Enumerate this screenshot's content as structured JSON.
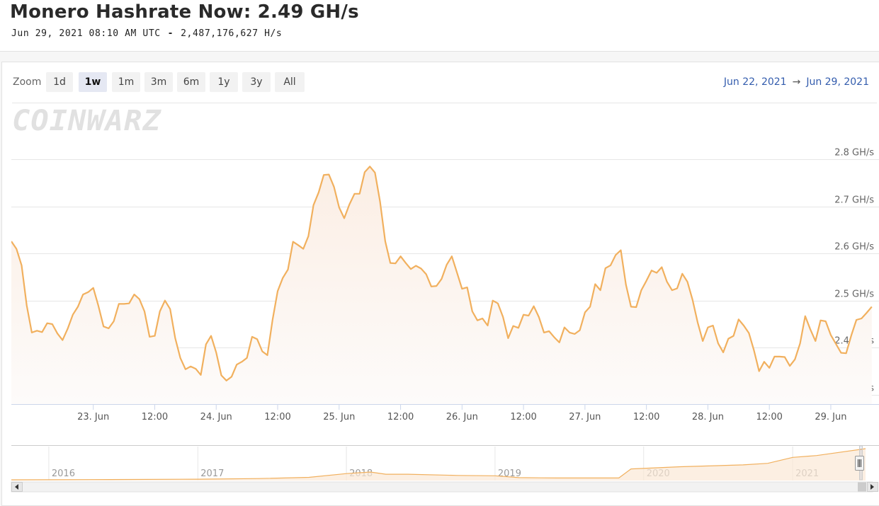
{
  "header": {
    "title": "Monero Hashrate Now: 2.49 GH/s",
    "timestamp": "Jun 29, 2021 08:10 AM UTC",
    "separator": "-",
    "hashrate_exact": "2,487,176,627 H/s"
  },
  "toolbar": {
    "zoom_label": "Zoom",
    "zoom_buttons": [
      "1d",
      "1w",
      "1m",
      "3m",
      "6m",
      "1y",
      "3y",
      "All"
    ],
    "active": "1w",
    "range_from": "Jun 22, 2021",
    "range_arrow": "→",
    "range_to": "Jun 29, 2021"
  },
  "watermark": "COINWARZ",
  "colors": {
    "line": "#f1b05e",
    "area_top": "#fbeee4",
    "area_bottom": "#fdfbfa",
    "grid": "#e6e6e6",
    "range_text": "#335cad"
  },
  "chart_data": {
    "type": "area",
    "title": "Monero Hashrate Now: 2.49 GH/s",
    "xlabel": "",
    "ylabel": "",
    "y_unit": "GH/s",
    "ylim": [
      2.28,
      2.82
    ],
    "yticks": [
      2.3,
      2.4,
      2.5,
      2.6,
      2.7,
      2.8
    ],
    "ytick_labels": [
      "2.3 GH/s",
      "2.4 GH/s",
      "2.5 GH/s",
      "2.6 GH/s",
      "2.7 GH/s",
      "2.8 GH/s"
    ],
    "xlim": [
      "2021-06-22T08:00",
      "2021-06-29T08:10"
    ],
    "xticks": [
      "2021-06-23T00:00",
      "2021-06-23T12:00",
      "2021-06-24T00:00",
      "2021-06-24T12:00",
      "2021-06-25T00:00",
      "2021-06-25T12:00",
      "2021-06-26T00:00",
      "2021-06-26T12:00",
      "2021-06-27T00:00",
      "2021-06-27T12:00",
      "2021-06-28T00:00",
      "2021-06-28T12:00",
      "2021-06-29T00:00",
      "2021-06-29T12:00"
    ],
    "xtick_labels": [
      "23. Jun",
      "12:00",
      "24. Jun",
      "12:00",
      "25. Jun",
      "12:00",
      "26. Jun",
      "12:00",
      "27. Jun",
      "12:00",
      "28. Jun",
      "12:00",
      "29. Jun",
      "12:00"
    ],
    "grid": true,
    "legend": "none",
    "series": [
      {
        "values": [
          [
            "2021-06-22T08:00",
            2.626
          ],
          [
            "2021-06-22T09:00",
            2.61
          ],
          [
            "2021-06-22T10:00",
            2.575
          ],
          [
            "2021-06-22T11:00",
            2.49
          ],
          [
            "2021-06-22T12:00",
            2.432
          ],
          [
            "2021-06-22T13:00",
            2.436
          ],
          [
            "2021-06-22T14:00",
            2.433
          ],
          [
            "2021-06-22T15:00",
            2.452
          ],
          [
            "2021-06-22T16:00",
            2.45
          ],
          [
            "2021-06-22T17:00",
            2.43
          ],
          [
            "2021-06-22T18:00",
            2.416
          ],
          [
            "2021-06-22T19:00",
            2.44
          ],
          [
            "2021-06-22T20:00",
            2.47
          ],
          [
            "2021-06-22T21:00",
            2.487
          ],
          [
            "2021-06-22T22:00",
            2.513
          ],
          [
            "2021-06-22T23:00",
            2.518
          ],
          [
            "2021-06-23T00:00",
            2.527
          ],
          [
            "2021-06-23T01:00",
            2.489
          ],
          [
            "2021-06-23T02:00",
            2.445
          ],
          [
            "2021-06-23T03:00",
            2.441
          ],
          [
            "2021-06-23T04:00",
            2.456
          ],
          [
            "2021-06-23T05:00",
            2.493
          ],
          [
            "2021-06-23T06:00",
            2.493
          ],
          [
            "2021-06-23T07:00",
            2.494
          ],
          [
            "2021-06-23T08:00",
            2.513
          ],
          [
            "2021-06-23T09:00",
            2.503
          ],
          [
            "2021-06-23T10:00",
            2.477
          ],
          [
            "2021-06-23T11:00",
            2.423
          ],
          [
            "2021-06-23T12:00",
            2.425
          ],
          [
            "2021-06-23T13:00",
            2.477
          ],
          [
            "2021-06-23T14:00",
            2.5
          ],
          [
            "2021-06-23T15:00",
            2.482
          ],
          [
            "2021-06-23T16:00",
            2.42
          ],
          [
            "2021-06-23T17:00",
            2.378
          ],
          [
            "2021-06-23T18:00",
            2.354
          ],
          [
            "2021-06-23T19:00",
            2.36
          ],
          [
            "2021-06-23T20:00",
            2.355
          ],
          [
            "2021-06-23T21:00",
            2.342
          ],
          [
            "2021-06-23T22:00",
            2.407
          ],
          [
            "2021-06-23T23:00",
            2.425
          ],
          [
            "2021-06-24T00:00",
            2.39
          ],
          [
            "2021-06-24T01:00",
            2.341
          ],
          [
            "2021-06-24T02:00",
            2.33
          ],
          [
            "2021-06-24T03:00",
            2.338
          ],
          [
            "2021-06-24T04:00",
            2.364
          ],
          [
            "2021-06-24T05:00",
            2.37
          ],
          [
            "2021-06-24T06:00",
            2.378
          ],
          [
            "2021-06-24T07:00",
            2.423
          ],
          [
            "2021-06-24T08:00",
            2.418
          ],
          [
            "2021-06-24T09:00",
            2.392
          ],
          [
            "2021-06-24T10:00",
            2.384
          ],
          [
            "2021-06-24T11:00",
            2.459
          ],
          [
            "2021-06-24T12:00",
            2.52
          ],
          [
            "2021-06-24T13:00",
            2.548
          ],
          [
            "2021-06-24T14:00",
            2.566
          ],
          [
            "2021-06-24T15:00",
            2.625
          ],
          [
            "2021-06-24T16:00",
            2.618
          ],
          [
            "2021-06-24T17:00",
            2.61
          ],
          [
            "2021-06-24T18:00",
            2.637
          ],
          [
            "2021-06-24T19:00",
            2.703
          ],
          [
            "2021-06-24T20:00",
            2.73
          ],
          [
            "2021-06-24T21:00",
            2.767
          ],
          [
            "2021-06-24T22:00",
            2.768
          ],
          [
            "2021-06-24T23:00",
            2.742
          ],
          [
            "2021-06-25T00:00",
            2.698
          ],
          [
            "2021-06-25T01:00",
            2.675
          ],
          [
            "2021-06-25T02:00",
            2.704
          ],
          [
            "2021-06-25T03:00",
            2.727
          ],
          [
            "2021-06-25T04:00",
            2.727
          ],
          [
            "2021-06-25T05:00",
            2.773
          ],
          [
            "2021-06-25T06:00",
            2.785
          ],
          [
            "2021-06-25T07:00",
            2.772
          ],
          [
            "2021-06-25T08:00",
            2.71
          ],
          [
            "2021-06-25T09:00",
            2.626
          ],
          [
            "2021-06-25T10:00",
            2.58
          ],
          [
            "2021-06-25T11:00",
            2.579
          ],
          [
            "2021-06-25T12:00",
            2.594
          ],
          [
            "2021-06-25T13:00",
            2.58
          ],
          [
            "2021-06-25T14:00",
            2.567
          ],
          [
            "2021-06-25T15:00",
            2.574
          ],
          [
            "2021-06-25T16:00",
            2.568
          ],
          [
            "2021-06-25T17:00",
            2.556
          ],
          [
            "2021-06-25T18:00",
            2.53
          ],
          [
            "2021-06-25T19:00",
            2.531
          ],
          [
            "2021-06-25T20:00",
            2.546
          ],
          [
            "2021-06-25T21:00",
            2.576
          ],
          [
            "2021-06-25T22:00",
            2.594
          ],
          [
            "2021-06-25T23:00",
            2.56
          ],
          [
            "2021-06-26T00:00",
            2.525
          ],
          [
            "2021-06-26T01:00",
            2.528
          ],
          [
            "2021-06-26T02:00",
            2.477
          ],
          [
            "2021-06-26T03:00",
            2.458
          ],
          [
            "2021-06-26T04:00",
            2.462
          ],
          [
            "2021-06-26T05:00",
            2.447
          ],
          [
            "2021-06-26T06:00",
            2.5
          ],
          [
            "2021-06-26T07:00",
            2.494
          ],
          [
            "2021-06-26T08:00",
            2.465
          ],
          [
            "2021-06-26T09:00",
            2.42
          ],
          [
            "2021-06-26T10:00",
            2.446
          ],
          [
            "2021-06-26T11:00",
            2.442
          ],
          [
            "2021-06-26T12:00",
            2.47
          ],
          [
            "2021-06-26T13:00",
            2.468
          ],
          [
            "2021-06-26T14:00",
            2.488
          ],
          [
            "2021-06-26T15:00",
            2.465
          ],
          [
            "2021-06-26T16:00",
            2.432
          ],
          [
            "2021-06-26T17:00",
            2.435
          ],
          [
            "2021-06-26T18:00",
            2.422
          ],
          [
            "2021-06-26T19:00",
            2.411
          ],
          [
            "2021-06-26T20:00",
            2.443
          ],
          [
            "2021-06-26T21:00",
            2.432
          ],
          [
            "2021-06-26T22:00",
            2.429
          ],
          [
            "2021-06-26T23:00",
            2.437
          ],
          [
            "2021-06-27T00:00",
            2.475
          ],
          [
            "2021-06-27T01:00",
            2.487
          ],
          [
            "2021-06-27T02:00",
            2.535
          ],
          [
            "2021-06-27T03:00",
            2.522
          ],
          [
            "2021-06-27T04:00",
            2.569
          ],
          [
            "2021-06-27T05:00",
            2.575
          ],
          [
            "2021-06-27T06:00",
            2.597
          ],
          [
            "2021-06-27T07:00",
            2.607
          ],
          [
            "2021-06-27T08:00",
            2.534
          ],
          [
            "2021-06-27T09:00",
            2.487
          ],
          [
            "2021-06-27T10:00",
            2.486
          ],
          [
            "2021-06-27T11:00",
            2.522
          ],
          [
            "2021-06-27T12:00",
            2.542
          ],
          [
            "2021-06-27T13:00",
            2.564
          ],
          [
            "2021-06-27T14:00",
            2.559
          ],
          [
            "2021-06-27T15:00",
            2.571
          ],
          [
            "2021-06-27T16:00",
            2.54
          ],
          [
            "2021-06-27T17:00",
            2.522
          ],
          [
            "2021-06-27T18:00",
            2.526
          ],
          [
            "2021-06-27T19:00",
            2.557
          ],
          [
            "2021-06-27T20:00",
            2.54
          ],
          [
            "2021-06-27T21:00",
            2.502
          ],
          [
            "2021-06-27T22:00",
            2.454
          ],
          [
            "2021-06-27T23:00",
            2.414
          ],
          [
            "2021-06-28T00:00",
            2.443
          ],
          [
            "2021-06-28T01:00",
            2.447
          ],
          [
            "2021-06-28T02:00",
            2.409
          ],
          [
            "2021-06-28T03:00",
            2.39
          ],
          [
            "2021-06-28T04:00",
            2.419
          ],
          [
            "2021-06-28T05:00",
            2.425
          ],
          [
            "2021-06-28T06:00",
            2.46
          ],
          [
            "2021-06-28T07:00",
            2.447
          ],
          [
            "2021-06-28T08:00",
            2.431
          ],
          [
            "2021-06-28T09:00",
            2.394
          ],
          [
            "2021-06-28T10:00",
            2.35
          ],
          [
            "2021-06-28T11:00",
            2.37
          ],
          [
            "2021-06-28T12:00",
            2.357
          ],
          [
            "2021-06-28T13:00",
            2.381
          ],
          [
            "2021-06-28T14:00",
            2.381
          ],
          [
            "2021-06-28T15:00",
            2.38
          ],
          [
            "2021-06-28T16:00",
            2.361
          ],
          [
            "2021-06-28T17:00",
            2.375
          ],
          [
            "2021-06-28T18:00",
            2.409
          ],
          [
            "2021-06-28T19:00",
            2.467
          ],
          [
            "2021-06-28T20:00",
            2.439
          ],
          [
            "2021-06-28T21:00",
            2.414
          ],
          [
            "2021-06-28T22:00",
            2.458
          ],
          [
            "2021-06-28T23:00",
            2.456
          ],
          [
            "2021-06-29T00:00",
            2.427
          ],
          [
            "2021-06-29T01:00",
            2.408
          ],
          [
            "2021-06-29T02:00",
            2.389
          ],
          [
            "2021-06-29T03:00",
            2.388
          ],
          [
            "2021-06-29T04:00",
            2.426
          ],
          [
            "2021-06-29T05:00",
            2.459
          ],
          [
            "2021-06-29T06:00",
            2.462
          ],
          [
            "2021-06-29T07:00",
            2.474
          ],
          [
            "2021-06-29T08:00",
            2.487
          ]
        ]
      }
    ],
    "navigator": {
      "xtick_labels": [
        "2016",
        "2017",
        "2018",
        "2019",
        "2020",
        "2021"
      ],
      "xlim": [
        "2015-10-01",
        "2021-06-29"
      ],
      "values": [
        [
          "2015-10-01",
          0.0
        ],
        [
          "2016-06-01",
          0.01
        ],
        [
          "2017-01-01",
          0.02
        ],
        [
          "2017-06-01",
          0.04
        ],
        [
          "2017-10-01",
          0.08
        ],
        [
          "2018-01-01",
          0.2
        ],
        [
          "2018-03-01",
          0.25
        ],
        [
          "2018-04-08",
          0.18
        ],
        [
          "2018-06-01",
          0.18
        ],
        [
          "2018-10-01",
          0.14
        ],
        [
          "2019-01-01",
          0.13
        ],
        [
          "2019-03-01",
          0.07
        ],
        [
          "2019-06-01",
          0.06
        ],
        [
          "2019-11-01",
          0.06
        ],
        [
          "2019-12-01",
          0.35
        ],
        [
          "2020-04-01",
          0.42
        ],
        [
          "2020-09-01",
          0.48
        ],
        [
          "2020-11-01",
          0.53
        ],
        [
          "2021-01-01",
          0.72
        ],
        [
          "2021-03-01",
          0.78
        ],
        [
          "2021-06-29",
          1.0
        ]
      ]
    }
  }
}
